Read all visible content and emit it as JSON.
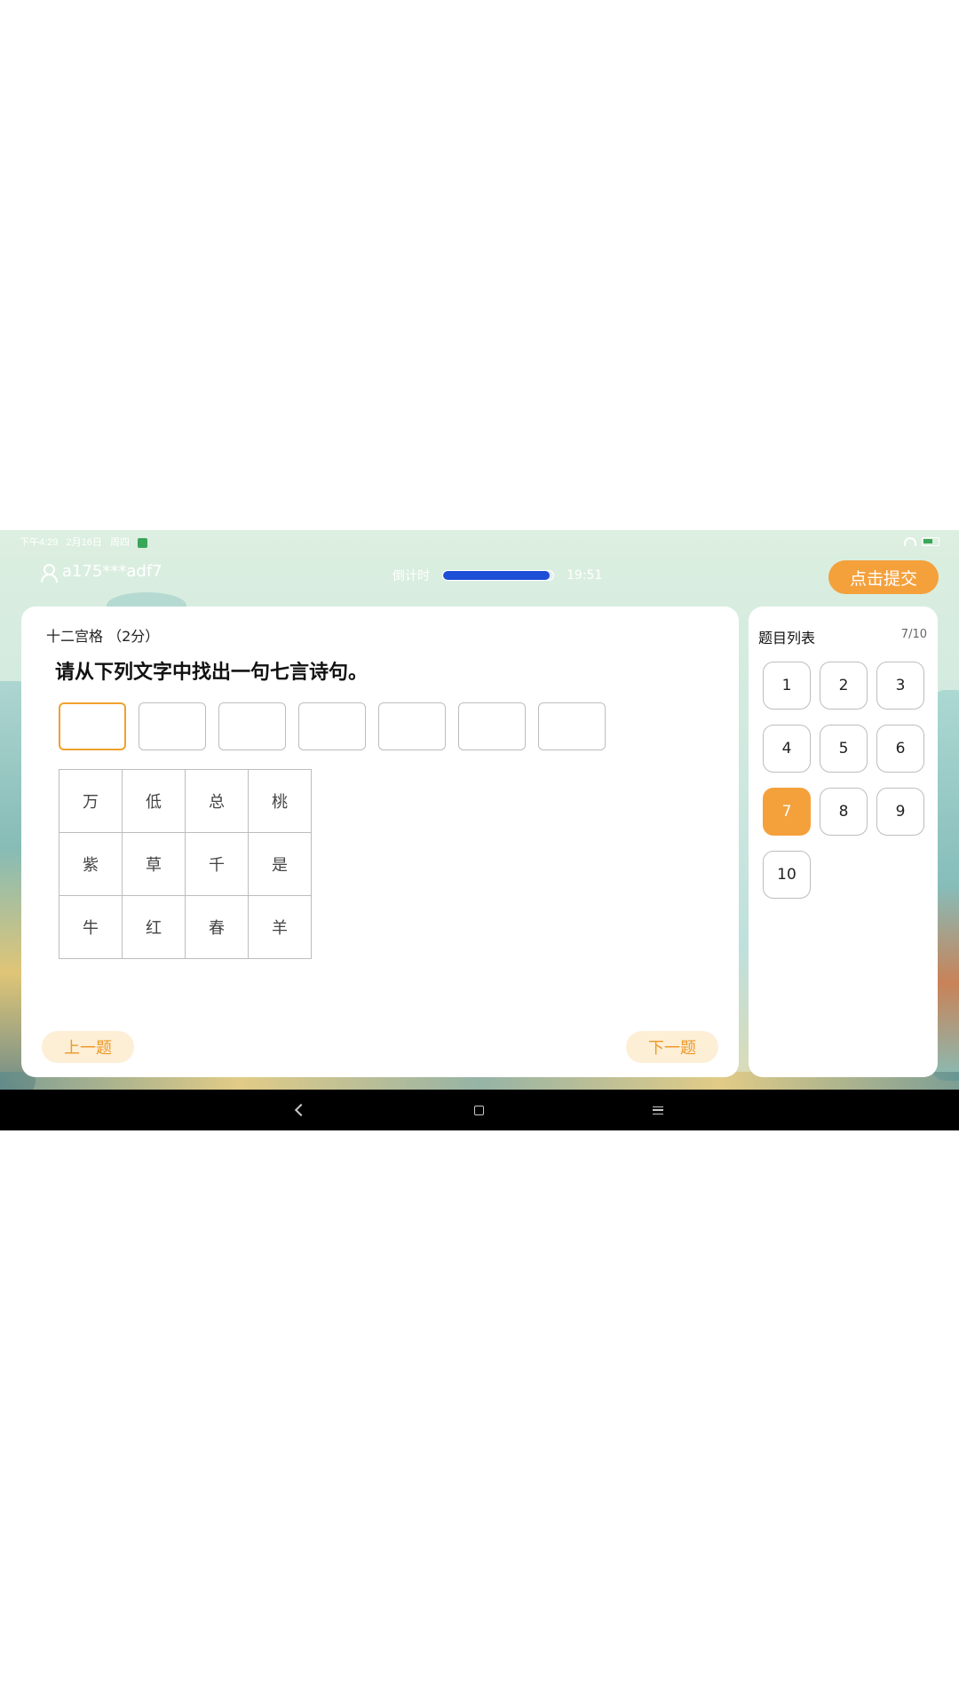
{
  "status_bar": {
    "time": "下午4:29",
    "date": "2月16日",
    "weekday": "周四"
  },
  "header": {
    "username": "a175***adf7",
    "timer_label": "倒计时",
    "timer_value": "19:51",
    "timer_progress": 0.97,
    "submit_label": "点击提交"
  },
  "question": {
    "type_label": "十二宫格 （2分）",
    "prompt": "请从下列文字中找出一句七言诗句。",
    "answer_slots": 7,
    "grid": [
      "万",
      "低",
      "总",
      "桃",
      "紫",
      "草",
      "千",
      "是",
      "牛",
      "红",
      "春",
      "羊"
    ],
    "prev_label": "上一题",
    "next_label": "下一题"
  },
  "panel": {
    "title": "题目列表",
    "progress": "7/10",
    "numbers": [
      "1",
      "2",
      "3",
      "4",
      "5",
      "6",
      "7",
      "8",
      "9",
      "10"
    ],
    "current": "7"
  },
  "colors": {
    "accent": "#f4a13c",
    "timer_fill": "#1d4fd6"
  }
}
